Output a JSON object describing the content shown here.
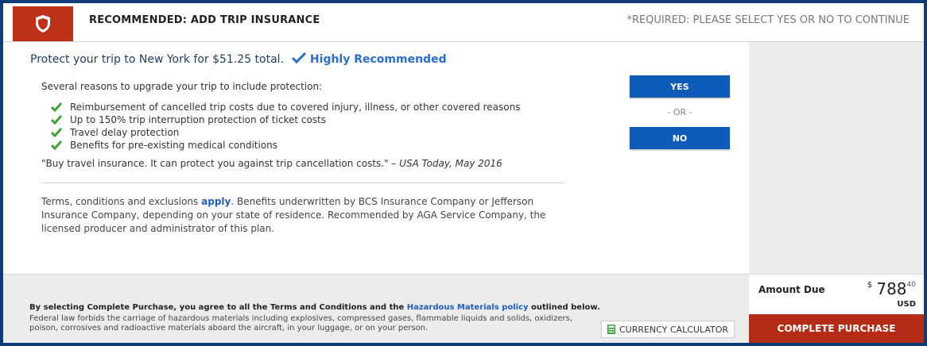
{
  "colors": {
    "brand_red": "#c0311a",
    "primary_blue": "#0e5bb8",
    "check_green": "#3aa53a",
    "page_border": "#0f3c78"
  },
  "header": {
    "icon": "shield-icon",
    "title": "RECOMMENDED: ADD TRIP INSURANCE",
    "required_note": "*REQUIRED: PLEASE SELECT YES OR NO TO CONTINUE"
  },
  "offer": {
    "protect_text": "Protect your trip to New York for $51.25 total.",
    "recommendation": "Highly Recommended",
    "reasons_intro": "Several reasons to upgrade your trip to include protection:",
    "benefits": [
      "Reimbursement of cancelled trip costs due to covered injury, illness, or other covered reasons",
      "Up to 150% trip interruption protection of ticket costs",
      "Travel delay protection",
      "Benefits for pre-existing medical conditions"
    ],
    "quote_text": "\"Buy travel insurance. It can protect you against trip cancellation costs.\" –",
    "quote_source": "USA Today, May 2016",
    "terms_before": "Terms, conditions and exclusions",
    "terms_link": "apply",
    "terms_after": ". Benefits underwritten by BCS Insurance Company or Jefferson Insurance Company, depending on your state of residence. Recommended by AGA Service Company, the licensed producer and administrator of this plan."
  },
  "choice": {
    "yes_label": "YES",
    "or_label": "- OR -",
    "no_label": "NO"
  },
  "footer": {
    "agree_before": "By selecting Complete Purchase, you agree to all the Terms and Conditions and the",
    "agree_link": "Hazardous Materials policy",
    "agree_after": "outlined below.",
    "law_text": "Federal law forbids the carriage of hazardous materials including explosives, compressed gases, flammable liquids and solids, oxidizers, poison, corrosives and radioactive materials aboard the aircraft, in your luggage, or on your person.",
    "calculator_label": "CURRENCY CALCULATOR",
    "calculator_icon": "calculator-icon"
  },
  "purchase": {
    "amount_label": "Amount Due",
    "currency_symbol": "$",
    "amount_dollars": "788",
    "amount_cents": "40",
    "currency": "USD",
    "complete_label": "COMPLETE PURCHASE"
  }
}
